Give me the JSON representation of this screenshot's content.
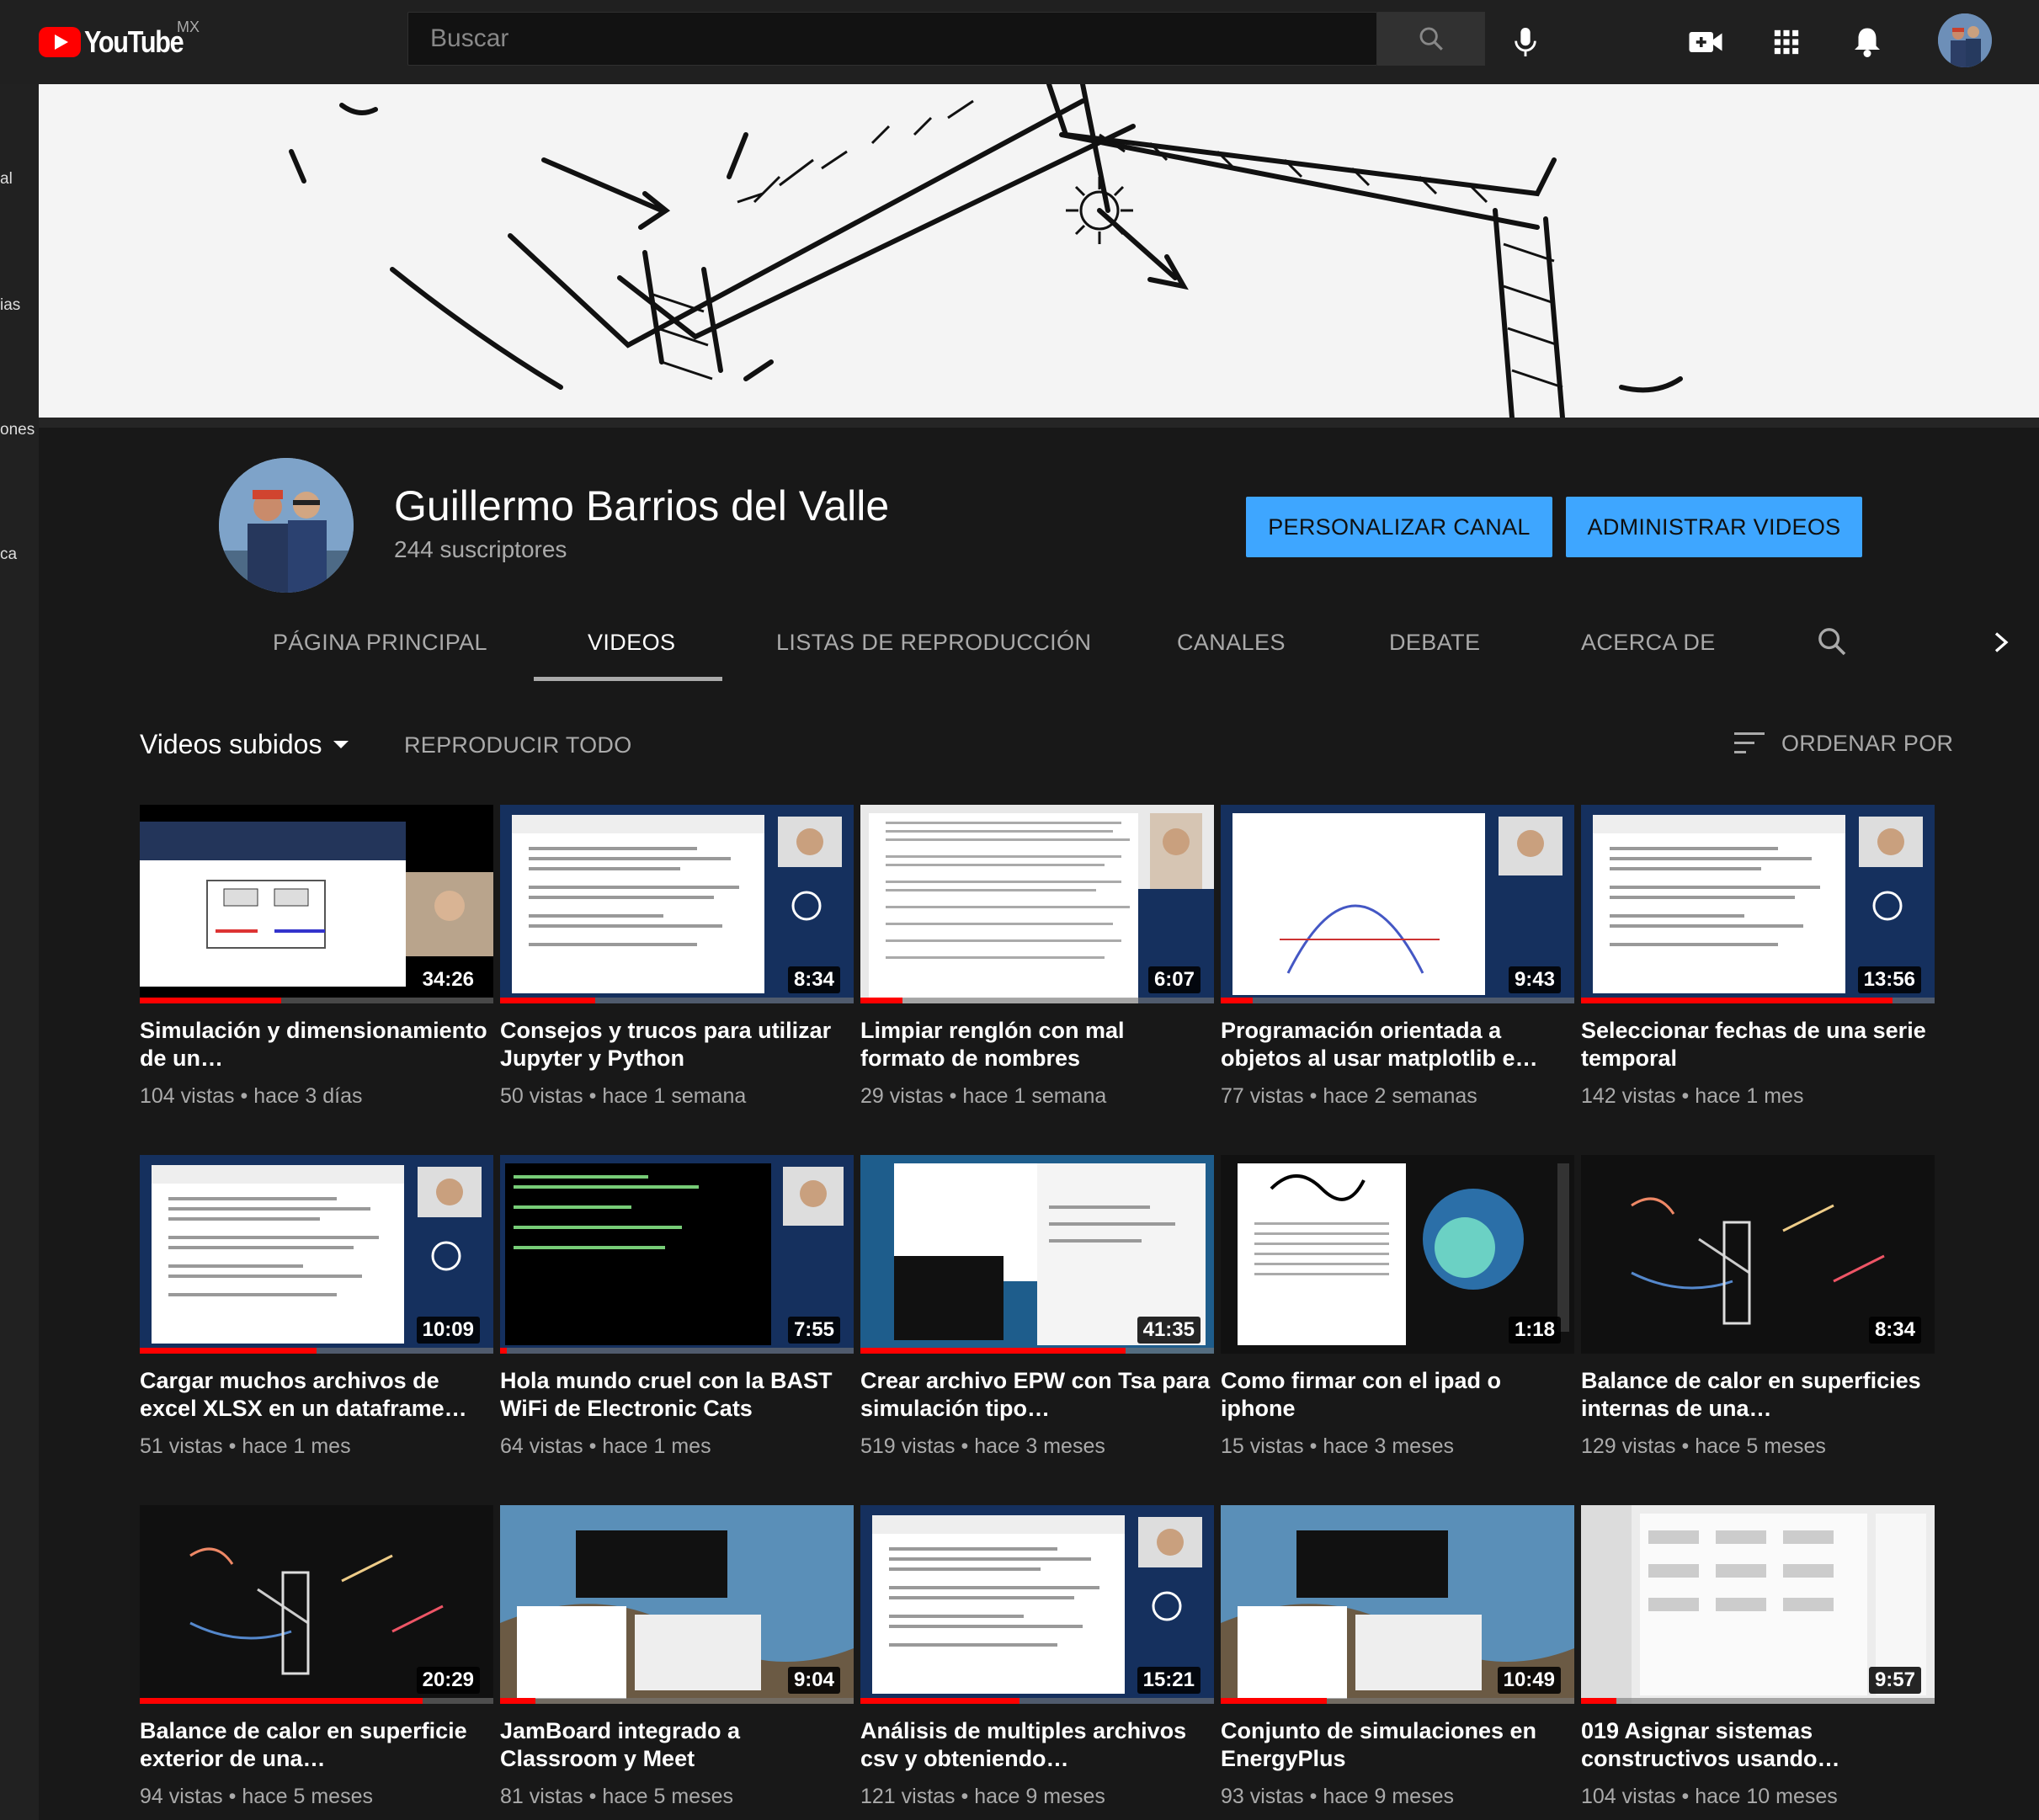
{
  "header": {
    "logo_text": "YouTube",
    "region": "MX",
    "search_placeholder": "Buscar",
    "icons": [
      "search-icon",
      "microphone-icon",
      "create-video-icon",
      "apps-grid-icon",
      "notifications-bell-icon",
      "account-avatar"
    ]
  },
  "sidebar": {
    "fragments": [
      "al",
      "ias",
      "ones",
      "ca"
    ]
  },
  "channel": {
    "name": "Guillermo Barrios del Valle",
    "subscribers": "244 suscriptores",
    "customize_button": "PERSONALIZAR CANAL",
    "manage_button": "ADMINISTRAR VIDEOS"
  },
  "tabs": [
    {
      "label": "PÁGINA PRINCIPAL",
      "active": false
    },
    {
      "label": "VIDEOS",
      "active": true
    },
    {
      "label": "LISTAS DE REPRODUCCIÓN",
      "active": false
    },
    {
      "label": "CANALES",
      "active": false
    },
    {
      "label": "DEBATE",
      "active": false
    },
    {
      "label": "ACERCA DE",
      "active": false
    }
  ],
  "tab_icons": [
    "search-icon",
    "chevron-right-icon"
  ],
  "section": {
    "title": "Videos subidos",
    "play_all": "REPRODUCIR TODO",
    "sort_label": "ORDENAR POR"
  },
  "videos": [
    {
      "title": "Simulación y dimensionamiento de un…",
      "views": "104 vistas",
      "age": "hace 3 días",
      "duration": "34:26",
      "watched": 0.4,
      "thumb": "slides"
    },
    {
      "title": "Consejos y trucos para utilizar Jupyter y Python",
      "views": "50 vistas",
      "age": "hace 1 semana",
      "duration": "8:34",
      "watched": 0.27,
      "thumb": "jupyter"
    },
    {
      "title": "Limpiar renglón con mal formato de nombres",
      "views": "29 vistas",
      "age": "hace 1 semana",
      "duration": "6:07",
      "watched": 0.12,
      "thumb": "doc"
    },
    {
      "title": "Programación orientada a objetos al usar matplotlib e…",
      "views": "77 vistas",
      "age": "hace 2 semanas",
      "duration": "9:43",
      "watched": 0.09,
      "thumb": "plot"
    },
    {
      "title": "Seleccionar fechas de una serie temporal",
      "views": "142 vistas",
      "age": "hace 1 mes",
      "duration": "13:56",
      "watched": 0.88,
      "thumb": "jupyter"
    },
    {
      "title": "Cargar muchos archivos de excel XLSX en un dataframe…",
      "views": "51 vistas",
      "age": "hace 1 mes",
      "duration": "10:09",
      "watched": 0.5,
      "thumb": "jupyter"
    },
    {
      "title": "Hola mundo cruel con la BAST WiFi de Electronic Cats",
      "views": "64 vistas",
      "age": "hace 1 mes",
      "duration": "7:55",
      "watched": 0.02,
      "thumb": "terminal"
    },
    {
      "title": "Crear archivo EPW con Tsa para simulación tipo…",
      "views": "519 vistas",
      "age": "hace 3 meses",
      "duration": "41:35",
      "watched": 0.75,
      "thumb": "desktop"
    },
    {
      "title": "Como firmar con el ipad o iphone",
      "views": "15 vistas",
      "age": "hace 3 meses",
      "duration": "1:18",
      "watched": 0.0,
      "thumb": "sign"
    },
    {
      "title": "Balance de calor en superficies internas de una…",
      "views": "129 vistas",
      "age": "hace 5 meses",
      "duration": "8:34",
      "watched": 0.0,
      "thumb": "board"
    },
    {
      "title": "Balance de calor en superficie exterior de una…",
      "views": "94 vistas",
      "age": "hace 5 meses",
      "duration": "20:29",
      "watched": 0.8,
      "thumb": "board"
    },
    {
      "title": "JamBoard integrado a Classroom y Meet",
      "views": "81 vistas",
      "age": "hace 5 meses",
      "duration": "9:04",
      "watched": 0.1,
      "thumb": "mac"
    },
    {
      "title": "Análisis de multiples archivos csv y obteniendo…",
      "views": "121 vistas",
      "age": "hace 9 meses",
      "duration": "15:21",
      "watched": 0.45,
      "thumb": "jupyter"
    },
    {
      "title": "Conjunto de simulaciones en EnergyPlus",
      "views": "93 vistas",
      "age": "hace 9 meses",
      "duration": "10:49",
      "watched": 0.3,
      "thumb": "mac"
    },
    {
      "title": "019 Asignar sistemas constructivos usando…",
      "views": "104 vistas",
      "age": "hace 10 meses",
      "duration": "9:57",
      "watched": 0.1,
      "thumb": "app"
    }
  ],
  "colors": {
    "accent_blue": "#3ea6ff",
    "progress_red": "#ff0000",
    "background": "#181818",
    "header": "#202020"
  }
}
